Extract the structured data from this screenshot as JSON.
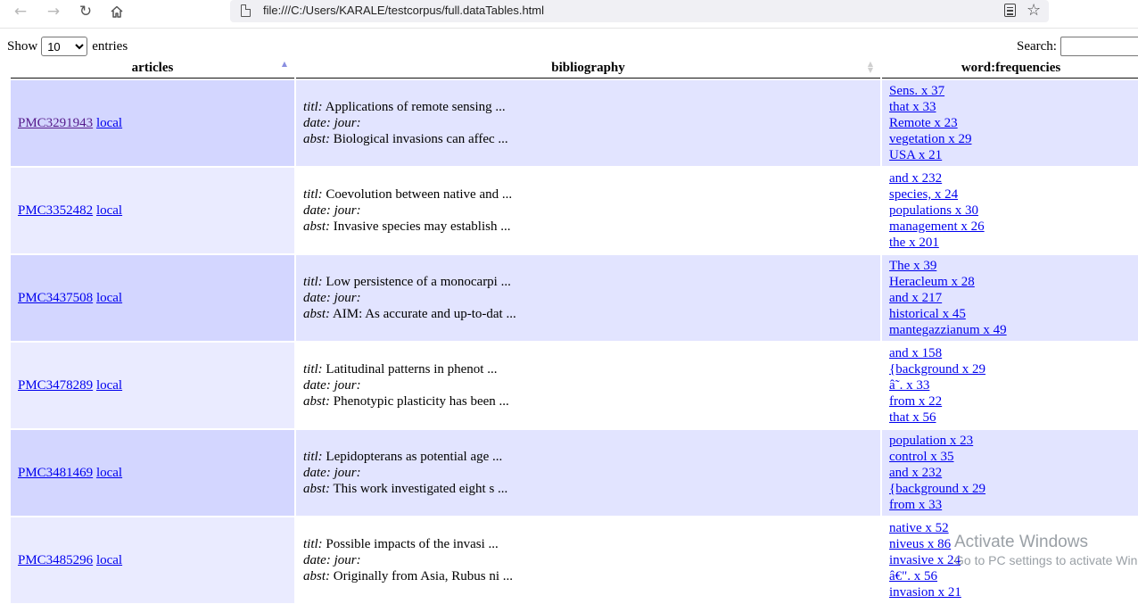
{
  "browser": {
    "url": "file:///C:/Users/KARALE/testcorpus/full.dataTables.html"
  },
  "controls": {
    "show_label": "Show",
    "length_value": "10",
    "entries_label": "entries",
    "search_label": "Search:"
  },
  "table": {
    "headers": [
      "articles",
      "bibliography",
      "word:frequencies"
    ],
    "rows": [
      {
        "pmc": "PMC3291943",
        "local": "local",
        "titl": "Applications of remote sensing ...",
        "date": "",
        "jour": "",
        "abst": "Biological invasions can affec ...",
        "freqs": [
          "Sens. x 37",
          "that x 33",
          "Remote x 23",
          "vegetation x 29",
          "USA x 21"
        ]
      },
      {
        "pmc": "PMC3352482",
        "local": "local",
        "titl": "Coevolution between native and ...",
        "date": "",
        "jour": "",
        "abst": "Invasive species may establish ...",
        "freqs": [
          "and x 232",
          "species, x 24",
          "populations x 30",
          "management x 26",
          "the x 201"
        ]
      },
      {
        "pmc": "PMC3437508",
        "local": "local",
        "titl": "Low persistence of a monocarpi ...",
        "date": "",
        "jour": "",
        "abst": "AIM: As accurate and up-to-dat ...",
        "freqs": [
          "The x 39",
          "Heracleum x 28",
          "and x 217",
          "historical x 45",
          "mantegazzianum x 49"
        ]
      },
      {
        "pmc": "PMC3478289",
        "local": "local",
        "titl": "Latitudinal patterns in phenot ...",
        "date": "",
        "jour": "",
        "abst": "Phenotypic plasticity has been ...",
        "freqs": [
          "and x 158",
          "{background x 29",
          "â˜. x 33",
          "from x 22",
          "that x 56"
        ]
      },
      {
        "pmc": "PMC3481469",
        "local": "local",
        "titl": "Lepidopterans as potential age ...",
        "date": "",
        "jour": "",
        "abst": "This work investigated eight s ...",
        "freqs": [
          "population x 23",
          "control x 35",
          "and x 232",
          "{background x 29",
          "from x 33"
        ]
      },
      {
        "pmc": "PMC3485296",
        "local": "local",
        "titl": "Possible impacts of the invasi ...",
        "date": "",
        "jour": "",
        "abst": "Originally from Asia, Rubus ni ...",
        "freqs": [
          "native x 52",
          "niveus x 86",
          "invasive x 24",
          "â€\". x 56",
          "invasion x 21"
        ]
      }
    ],
    "field_labels": {
      "titl": "titl:",
      "date": "date:",
      "jour": "jour:",
      "abst": "abst:"
    }
  },
  "watermark": {
    "line1": "Activate Windows",
    "line2": "Go to PC settings to activate Windows."
  },
  "colors": {
    "odd_row": "#e2e4ff",
    "odd_row_sorted": "#d3d6ff",
    "even_row_sorted": "#eaebff",
    "link": "#0000ee",
    "visited_link": "#551a8b"
  }
}
